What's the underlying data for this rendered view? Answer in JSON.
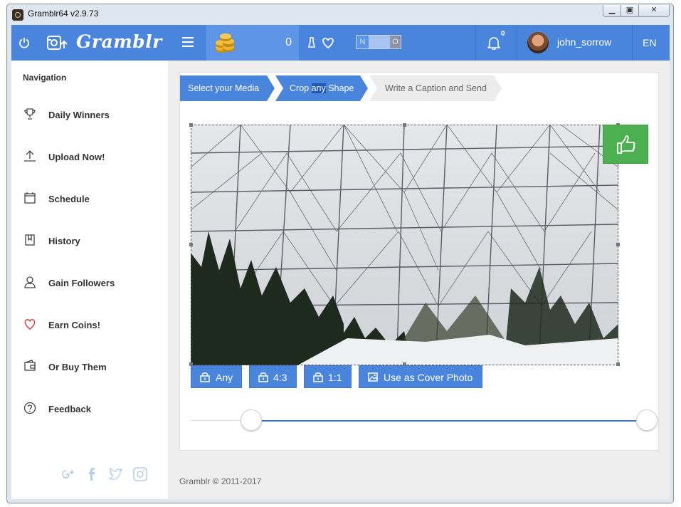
{
  "window": {
    "title": "Gramblr64 v2.9.73",
    "min": "▁",
    "max": "▣",
    "close": "✕"
  },
  "appbar": {
    "brand": "Gramblr",
    "coins": "0",
    "toggle_on": "N",
    "toggle_off": "O",
    "notifications": "0",
    "username": "john_sorrow",
    "language": "EN",
    "accent": "#4a85dd"
  },
  "sidebar": {
    "heading": "Navigation",
    "items": [
      {
        "label": "Daily Winners",
        "icon": "trophy-icon"
      },
      {
        "label": "Upload Now!",
        "icon": "upload-icon"
      },
      {
        "label": "Schedule",
        "icon": "calendar-icon"
      },
      {
        "label": "History",
        "icon": "bookmark-icon"
      },
      {
        "label": "Gain Followers",
        "icon": "user-icon"
      },
      {
        "label": "Earn Coins!",
        "icon": "heart-icon"
      },
      {
        "label": "Or Buy Them",
        "icon": "wallet-icon"
      },
      {
        "label": "Feedback",
        "icon": "help-icon"
      }
    ]
  },
  "steps": {
    "step1": "Select your Media",
    "step2_a": "Crop ",
    "step2_hl": "any",
    "step2_b": " Shape",
    "step3": "Write a Caption and Send"
  },
  "crop": {
    "ratios": [
      "Any",
      "4:3",
      "1:1"
    ],
    "cover": "Use as Cover Photo"
  },
  "slider": {
    "min_fraction": 0.13,
    "max_fraction": 1.0
  },
  "footer": {
    "text": "Gramblr © 2011-2017"
  }
}
